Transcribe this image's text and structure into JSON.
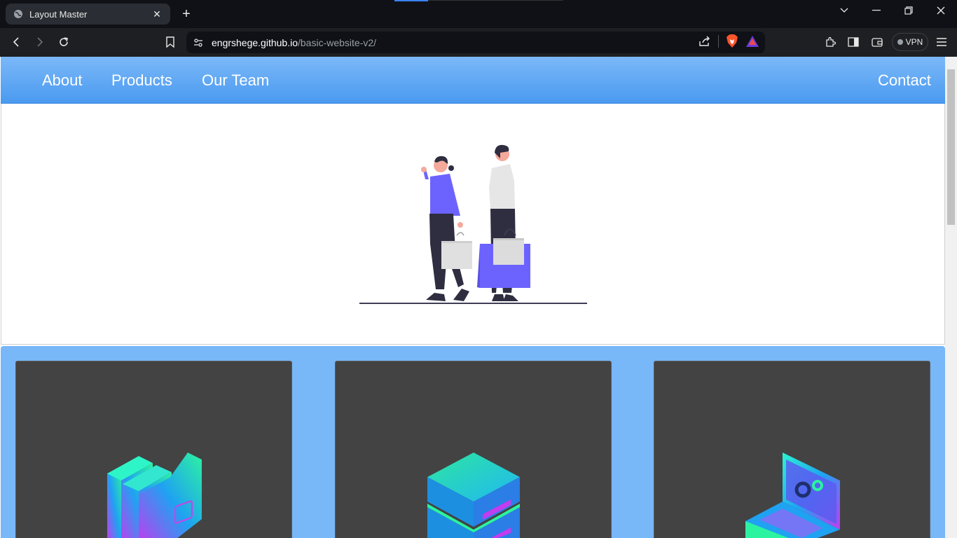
{
  "browser": {
    "tab_title": "Layout Master",
    "url_host": "engrshege.github.io",
    "url_path": "/basic-website-v2/",
    "vpn_label": "VPN"
  },
  "nav": {
    "links": [
      {
        "label": "About"
      },
      {
        "label": "Products"
      },
      {
        "label": "Our Team"
      }
    ],
    "contact": "Contact"
  },
  "hero": {
    "illustration": "shopping-couple-illustration"
  },
  "products": {
    "cards": [
      {
        "icon": "folders-icon"
      },
      {
        "icon": "server-icon"
      },
      {
        "icon": "laptop-settings-icon"
      }
    ]
  },
  "colors": {
    "nav_gradient_top": "#7bb8f8",
    "nav_gradient_bottom": "#4a9af0",
    "products_bg": "#78b7f8",
    "card_bg": "#434343",
    "accent_purple": "#6c63ff"
  }
}
